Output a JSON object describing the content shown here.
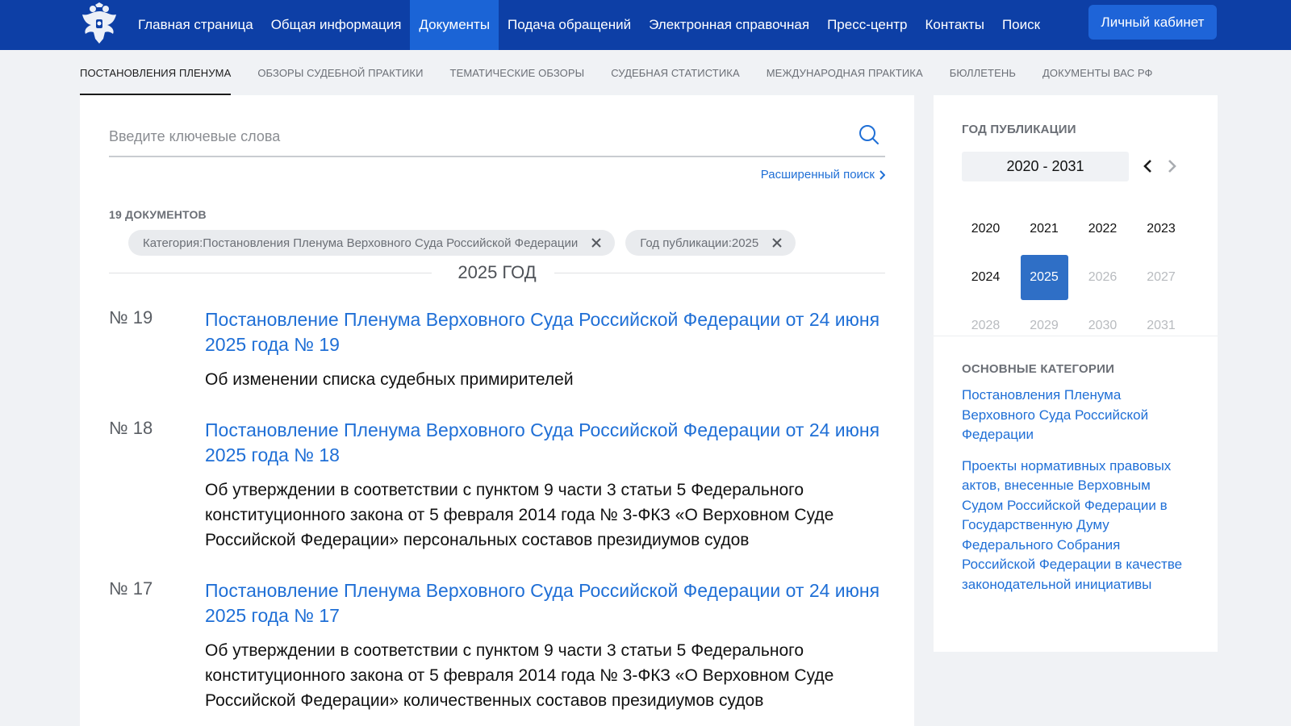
{
  "header": {
    "logo_icon": "coat-of-arms-icon",
    "nav": [
      {
        "label": "Главная страница",
        "active": false
      },
      {
        "label": "Общая информация",
        "active": false
      },
      {
        "label": "Документы",
        "active": true
      },
      {
        "label": "Подача обращений",
        "active": false
      },
      {
        "label": "Электронная справочная",
        "active": false
      },
      {
        "label": "Пресс-центр",
        "active": false
      },
      {
        "label": "Контакты",
        "active": false
      },
      {
        "label": "Поиск",
        "active": false
      }
    ],
    "cabinet_label": "Личный кабинет"
  },
  "subnav": [
    {
      "label": "ПОСТАНОВЛЕНИЯ ПЛЕНУМА",
      "active": true
    },
    {
      "label": "ОБЗОРЫ СУДЕБНОЙ ПРАКТИКИ",
      "active": false
    },
    {
      "label": "ТЕМАТИЧЕСКИЕ ОБЗОРЫ",
      "active": false
    },
    {
      "label": "СУДЕБНАЯ СТАТИСТИКА",
      "active": false
    },
    {
      "label": "МЕЖДУНАРОДНАЯ ПРАКТИКА",
      "active": false
    },
    {
      "label": "БЮЛЛЕТЕНЬ",
      "active": false
    },
    {
      "label": "ДОКУМЕНТЫ ВАС РФ",
      "active": false
    }
  ],
  "search": {
    "placeholder": "Введите ключевые слова",
    "value": "",
    "advanced_label": "Расширенный поиск"
  },
  "results": {
    "count_label": "19 ДОКУМЕНТОВ",
    "filters": [
      {
        "label": "Категория:Постановления Пленума Верховного Суда Российской Федерации"
      },
      {
        "label": "Год публикации:2025"
      }
    ],
    "year_heading": "2025 ГОД",
    "documents": [
      {
        "number": "№ 19",
        "title": "Постановление Пленума Верховного Суда Российской Федерации от 24 июня 2025 года № 19",
        "description": "Об изменении списка судебных примирителей"
      },
      {
        "number": "№ 18",
        "title": "Постановление Пленума Верховного Суда Российской Федерации от 24 июня 2025 года № 18",
        "description": "Об утверждении в соответствии с пунктом 9 части 3 статьи 5 Федерального конституционного закона от 5 февраля 2014 года № 3-ФКЗ «О Верховном Суде Российской Федерации» персональных составов президиумов судов"
      },
      {
        "number": "№ 17",
        "title": "Постановление Пленума Верховного Суда Российской Федерации от 24 июня 2025 года № 17",
        "description": "Об утверждении в соответствии с пунктом 9 части 3 статьи 5 Федерального конституционного закона от 5 февраля 2014 года № 3-ФКЗ «О Верховном Суде Российской Федерации» количественных составов президиумов судов"
      }
    ]
  },
  "sidebar": {
    "year_heading": "ГОД ПУБЛИКАЦИИ",
    "range_label": "2020 - 2031",
    "years": [
      {
        "label": "2020",
        "state": "normal"
      },
      {
        "label": "2021",
        "state": "normal"
      },
      {
        "label": "2022",
        "state": "normal"
      },
      {
        "label": "2023",
        "state": "normal"
      },
      {
        "label": "2024",
        "state": "normal"
      },
      {
        "label": "2025",
        "state": "selected"
      },
      {
        "label": "2026",
        "state": "disabled"
      },
      {
        "label": "2027",
        "state": "disabled"
      },
      {
        "label": "2028",
        "state": "disabled"
      },
      {
        "label": "2029",
        "state": "disabled"
      },
      {
        "label": "2030",
        "state": "disabled"
      },
      {
        "label": "2031",
        "state": "disabled"
      }
    ],
    "categories_heading": "ОСНОВНЫЕ КАТЕГОРИИ",
    "categories": [
      {
        "label": "Постановления Пленума Верховного Суда Российской Федерации"
      },
      {
        "label": "Проекты нормативных правовых актов, внесенные Верховным Судом Российской Федерации в Государственную Думу Федерального Собрания Российской Федерации в качестве законодательной инициативы"
      }
    ]
  },
  "colors": {
    "header_bg": "#0d3fa6",
    "nav_active": "#1b64d6",
    "link": "#1f6fd6",
    "selected_year": "#2f6fc6",
    "page_bg": "#f0f2f5"
  }
}
